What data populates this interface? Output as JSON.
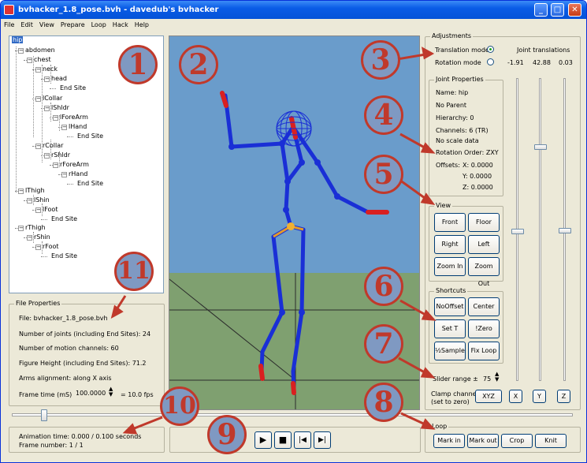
{
  "window": {
    "title": "bvhacker_1.8_pose.bvh - davedub's bvhacker",
    "minimize": "_",
    "maximize": "□",
    "close": "✕"
  },
  "menu": [
    "File",
    "Edit",
    "View",
    "Prepare",
    "Loop",
    "Hack",
    "Help"
  ],
  "tree": {
    "nodes": [
      {
        "label": "hip",
        "selected": true
      },
      {
        "label": "abdomen"
      },
      {
        "label": "chest"
      },
      {
        "label": "neck"
      },
      {
        "label": "head"
      },
      {
        "label": "End Site"
      },
      {
        "label": "lCollar"
      },
      {
        "label": "lShldr"
      },
      {
        "label": "lForeArm"
      },
      {
        "label": "lHand"
      },
      {
        "label": "End Site"
      },
      {
        "label": "rCollar"
      },
      {
        "label": "rShldr"
      },
      {
        "label": "rForeArm"
      },
      {
        "label": "rHand"
      },
      {
        "label": "End Site"
      },
      {
        "label": "lThigh"
      },
      {
        "label": "lShin"
      },
      {
        "label": "lFoot"
      },
      {
        "label": "End Site"
      },
      {
        "label": "rThigh"
      },
      {
        "label": "rShin"
      },
      {
        "label": "rFoot"
      },
      {
        "label": "End Site"
      }
    ]
  },
  "file_properties": {
    "legend": "File Properties",
    "file": "File: bvhacker_1.8_pose.bvh",
    "joints": "Number of joints (including End Sites): 24",
    "channels": "Number of motion channels: 60",
    "height": "Figure Height (including End Sites): 71.2",
    "arms": "Arms alignment: along X axis",
    "frame_time_label": "Frame time (mS)",
    "frame_time_value": "100.0000",
    "fps": "= 10.0 fps"
  },
  "animation": {
    "time": "Animation time: 0.000 / 0.100 seconds",
    "frame": "Frame number: 1 / 1",
    "timeline_position": 0.13
  },
  "playback": {
    "play": "▶",
    "stop": "■",
    "prev": "|◀",
    "next": "▶|"
  },
  "adjustments": {
    "legend": "Adjustments",
    "translation_mode": "Translation mode",
    "rotation_mode": "Rotation mode",
    "joint_translations": "Joint translations",
    "tx": "-1.91",
    "ty": "42.88",
    "tz": "0.03"
  },
  "joint_properties": {
    "legend": "Joint Properties",
    "name": "Name: hip",
    "parent": "No Parent",
    "hierarchy": "Hierarchy: 0",
    "channels": "Channels: 6 (TR)",
    "scale": "No scale data",
    "rotation_order": "Rotation Order: ZXY",
    "offsets_label": "Offsets:",
    "x": "X:  0.0000",
    "y": "Y:  0.0000",
    "z": "Z:  0.0000"
  },
  "view": {
    "legend": "View",
    "front": "Front",
    "floor": "Floor",
    "right": "Right",
    "left": "Left",
    "zoom_in": "Zoom In",
    "zoom_out": "Zoom Out"
  },
  "shortcuts": {
    "legend": "Shortcuts",
    "no_offset": "NoOffset",
    "center": "Center",
    "set_t": "Set T",
    "zero": "!Zero",
    "half_sample": "½Sample",
    "fix_loop": "Fix Loop"
  },
  "slider_range": {
    "label": "Slider range ±",
    "value": "75"
  },
  "clamp": {
    "label1": "Clamp channel",
    "label2": "(set to zero)",
    "xyz": "XYZ",
    "x": "X",
    "y": "Y",
    "z": "Z"
  },
  "loop": {
    "legend": "Loop",
    "mark_in": "Mark in",
    "mark_out": "Mark out",
    "crop": "Crop",
    "knit": "Knit"
  },
  "markers": [
    "1",
    "2",
    "3",
    "4",
    "5",
    "6",
    "7",
    "8",
    "9",
    "10",
    "11"
  ],
  "colors": {
    "sky": "#6a9ccb",
    "ground": "#7fa070",
    "bone": "#1a2fd6",
    "joint": "#1a2fd6",
    "accent_red": "#c0392b",
    "marker_fill": "#7f99c2"
  }
}
